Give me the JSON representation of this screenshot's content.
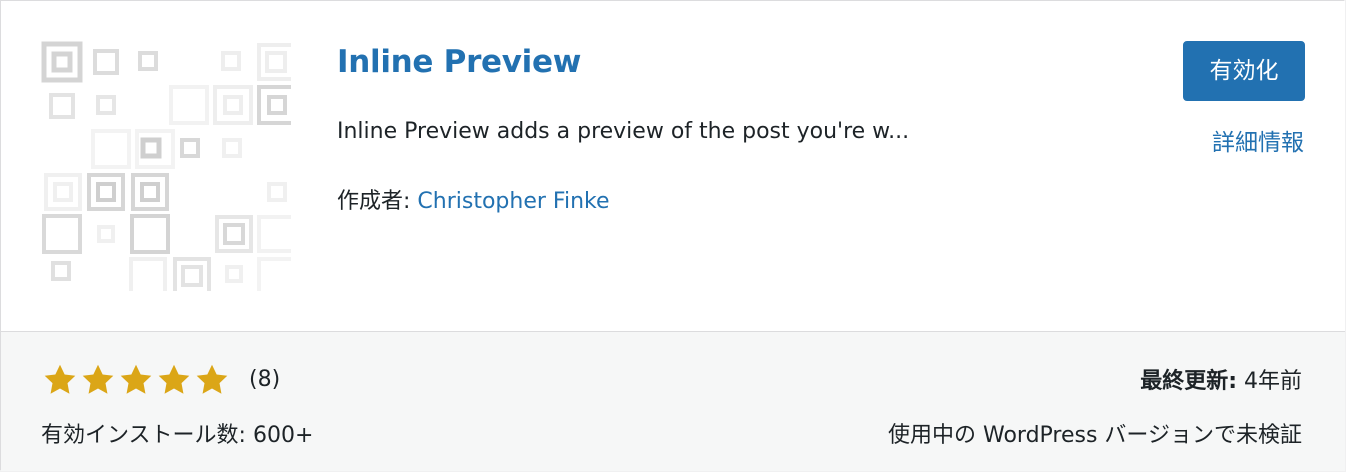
{
  "plugin": {
    "title": "Inline Preview",
    "description": "Inline Preview adds a preview of the post you're w...",
    "author_label": "作成者: ",
    "author_name": "Christopher Finke",
    "icon": "generated-pattern-icon"
  },
  "actions": {
    "activate_label": "有効化",
    "details_label": "詳細情報"
  },
  "footer": {
    "rating": {
      "stars": 5,
      "max_stars": 5,
      "count_text": "(8)"
    },
    "installs_text": "有効インストール数: 600+",
    "last_updated_label": "最終更新:",
    "last_updated_value": " 4年前",
    "compat_text": "使用中の WordPress バージョンで未検証"
  },
  "colors": {
    "link": "#2271b1",
    "button_bg": "#2271b1",
    "star": "#dba617",
    "footer_bg": "#f6f7f7",
    "border": "#dcdcde"
  }
}
